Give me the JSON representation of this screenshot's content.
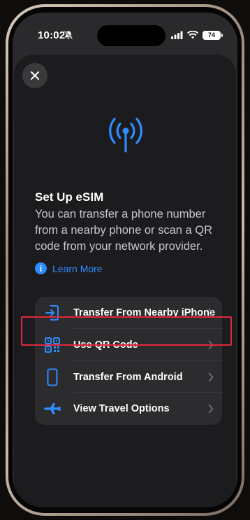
{
  "status_bar": {
    "time": "10:02",
    "battery": "74"
  },
  "sheet": {
    "title": "Set Up eSIM",
    "description": "You can transfer a phone number from a nearby phone or scan a QR code from your network provider.",
    "learn_more": "Learn More"
  },
  "options": [
    {
      "label": "Transfer From Nearby iPhone",
      "icon": "phone-transfer-icon"
    },
    {
      "label": "Use QR Code",
      "icon": "qr-code-icon"
    },
    {
      "label": "Transfer From Android",
      "icon": "android-phone-icon"
    },
    {
      "label": "View Travel Options",
      "icon": "airplane-icon"
    }
  ],
  "colors": {
    "accent": "#2f8cff",
    "highlight": "#e0283d",
    "sheet_bg": "#1c1c1e",
    "card_bg": "#2c2c2e"
  }
}
